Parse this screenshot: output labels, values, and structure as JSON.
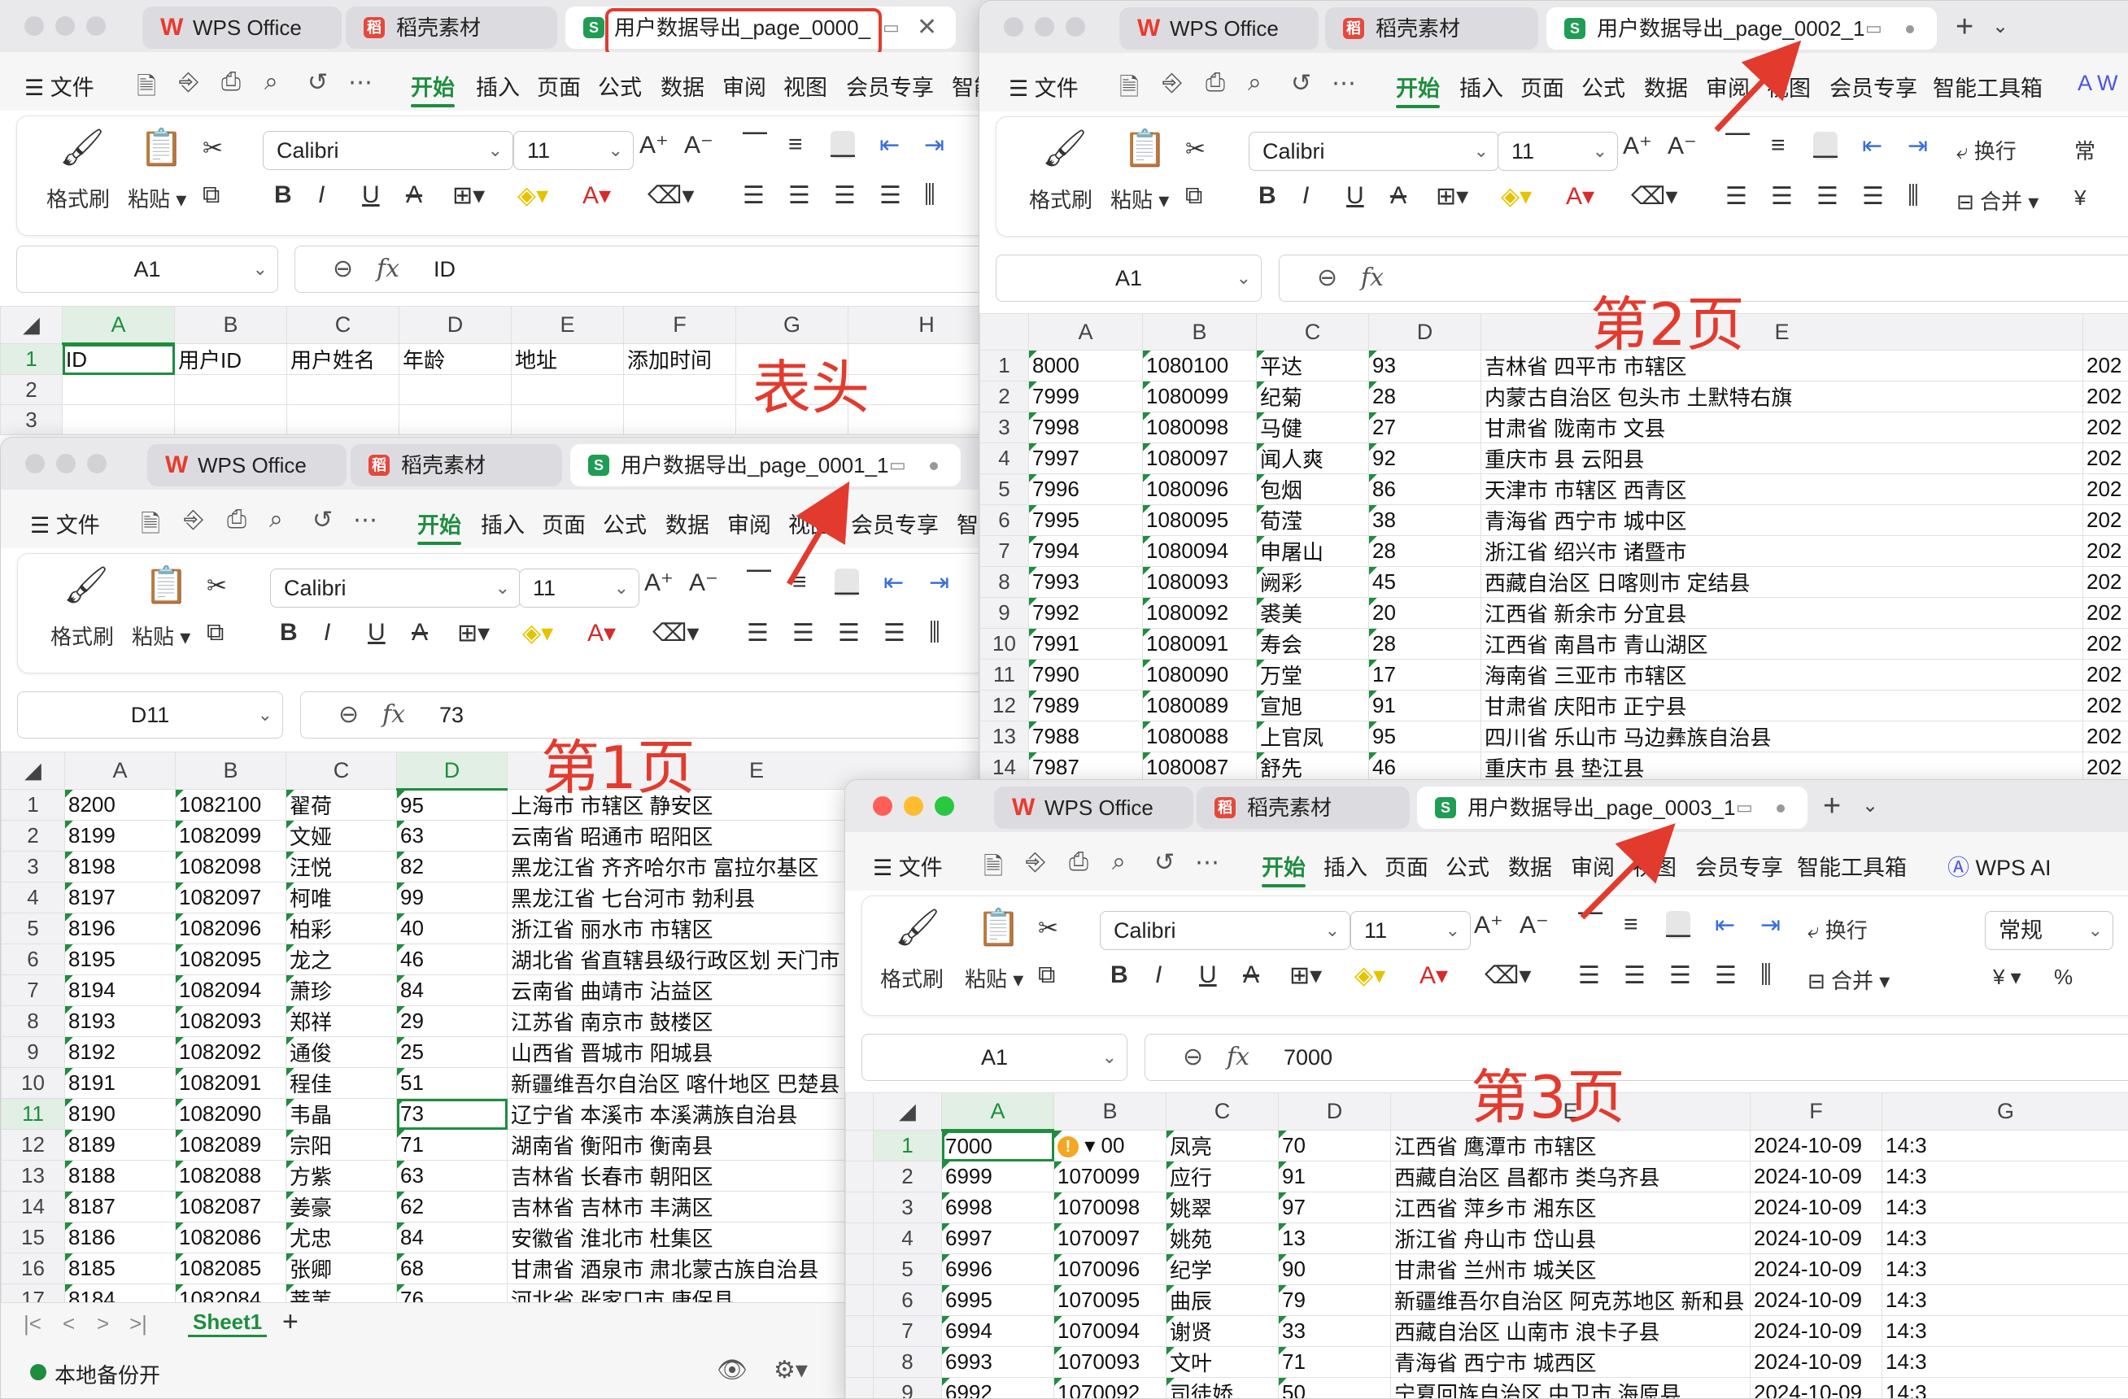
{
  "app": {
    "wps_tab": "WPS Office",
    "daoke_tab": "稻壳素材",
    "sheet_icon": "S",
    "wps_icon": "W",
    "daoke_icon": "稻"
  },
  "windows": [
    {
      "file_tab": "用户数据导出_page_0000_",
      "cell_ref": "A1",
      "formula_value": "ID"
    },
    {
      "file_tab": "用户数据导出_page_0001_1",
      "cell_ref": "D11",
      "formula_value": "73"
    },
    {
      "file_tab": "用户数据导出_page_0002_1",
      "cell_ref": "A1",
      "formula_value": ""
    },
    {
      "file_tab": "用户数据导出_page_0003_1",
      "cell_ref": "A1",
      "formula_value": "7000"
    }
  ],
  "menu": {
    "file": "文件",
    "items": [
      "开始",
      "插入",
      "页面",
      "公式",
      "数据",
      "审阅",
      "视图",
      "会员专享",
      "智能工具箱",
      "智能"
    ],
    "wps_ai": "WPS AI"
  },
  "ribbon": {
    "format_painter": "格式刷",
    "paste": "粘贴",
    "font_name": "Calibri",
    "font_size": "11",
    "wrap": "换行",
    "merge": "合并",
    "number_format": "常规",
    "number_format_short": "常"
  },
  "fx_label": "fx",
  "sheet0": {
    "columns": [
      "A",
      "B",
      "C",
      "D",
      "E",
      "F",
      "G",
      "H"
    ],
    "rows": [
      [
        "1",
        "ID",
        "用户ID",
        "用户姓名",
        "年龄",
        "地址",
        "添加时间",
        "",
        ""
      ],
      [
        "2",
        "",
        "",
        "",
        "",
        "",
        "",
        "",
        ""
      ],
      [
        "3",
        "",
        "",
        "",
        "",
        "",
        "",
        "",
        ""
      ]
    ]
  },
  "sheet1": {
    "columns": [
      "A",
      "B",
      "C",
      "D",
      "E"
    ],
    "rows": [
      [
        "1",
        "8200",
        "1082100",
        "翟荷",
        "95",
        "上海市 市辖区 静安区"
      ],
      [
        "2",
        "8199",
        "1082099",
        "文娅",
        "63",
        "云南省 昭通市 昭阳区"
      ],
      [
        "3",
        "8198",
        "1082098",
        "汪悦",
        "82",
        "黑龙江省 齐齐哈尔市 富拉尔基区"
      ],
      [
        "4",
        "8197",
        "1082097",
        "柯唯",
        "99",
        "黑龙江省 七台河市 勃利县"
      ],
      [
        "5",
        "8196",
        "1082096",
        "柏彩",
        "40",
        "浙江省 丽水市 市辖区"
      ],
      [
        "6",
        "8195",
        "1082095",
        "龙之",
        "46",
        "湖北省 省直辖县级行政区划 天门市"
      ],
      [
        "7",
        "8194",
        "1082094",
        "萧珍",
        "84",
        "云南省 曲靖市 沾益区"
      ],
      [
        "8",
        "8193",
        "1082093",
        "郑祥",
        "29",
        "江苏省 南京市 鼓楼区"
      ],
      [
        "9",
        "8192",
        "1082092",
        "通俊",
        "25",
        "山西省 晋城市 阳城县"
      ],
      [
        "10",
        "8191",
        "1082091",
        "程佳",
        "51",
        "新疆维吾尔自治区 喀什地区 巴楚县"
      ],
      [
        "11",
        "8190",
        "1082090",
        "韦晶",
        "73",
        "辽宁省 本溪市 本溪满族自治县"
      ],
      [
        "12",
        "8189",
        "1082089",
        "宗阳",
        "71",
        "湖南省 衡阳市 衡南县"
      ],
      [
        "13",
        "8188",
        "1082088",
        "方紫",
        "63",
        "吉林省 长春市 朝阳区"
      ],
      [
        "14",
        "8187",
        "1082087",
        "姜豪",
        "62",
        "吉林省 吉林市 丰满区"
      ],
      [
        "15",
        "8186",
        "1082086",
        "尤忠",
        "84",
        "安徽省 淮北市 杜集区"
      ],
      [
        "16",
        "8185",
        "1082085",
        "张卿",
        "68",
        "甘肃省 酒泉市 肃北蒙古族自治县"
      ],
      [
        "17",
        "8184",
        "1082084",
        "莘苇",
        "76",
        "河北省 张家口市 康保县"
      ]
    ],
    "sheet_tab": "Sheet1",
    "status": "本地备份开"
  },
  "sheet2": {
    "columns": [
      "A",
      "B",
      "C",
      "D",
      "E"
    ],
    "rows": [
      [
        "1",
        "8000",
        "1080100",
        "平达",
        "93",
        "吉林省 四平市 市辖区",
        "202"
      ],
      [
        "2",
        "7999",
        "1080099",
        "纪菊",
        "28",
        "内蒙古自治区 包头市 土默特右旗",
        "202"
      ],
      [
        "3",
        "7998",
        "1080098",
        "马健",
        "27",
        "甘肃省 陇南市 文县",
        "202"
      ],
      [
        "4",
        "7997",
        "1080097",
        "闻人爽",
        "92",
        "重庆市 县 云阳县",
        "202"
      ],
      [
        "5",
        "7996",
        "1080096",
        "包烟",
        "86",
        "天津市 市辖区 西青区",
        "202"
      ],
      [
        "6",
        "7995",
        "1080095",
        "荀滢",
        "38",
        "青海省 西宁市 城中区",
        "202"
      ],
      [
        "7",
        "7994",
        "1080094",
        "申屠山",
        "28",
        "浙江省 绍兴市 诸暨市",
        "202"
      ],
      [
        "8",
        "7993",
        "1080093",
        "阙彩",
        "45",
        "西藏自治区 日喀则市 定结县",
        "202"
      ],
      [
        "9",
        "7992",
        "1080092",
        "裘美",
        "20",
        "江西省 新余市 分宜县",
        "202"
      ],
      [
        "10",
        "7991",
        "1080091",
        "寿会",
        "28",
        "江西省 南昌市 青山湖区",
        "202"
      ],
      [
        "11",
        "7990",
        "1080090",
        "万堂",
        "17",
        "海南省 三亚市 市辖区",
        "202"
      ],
      [
        "12",
        "7989",
        "1080089",
        "宣旭",
        "91",
        "甘肃省 庆阳市 正宁县",
        "202"
      ],
      [
        "13",
        "7988",
        "1080088",
        "上官凤",
        "95",
        "四川省 乐山市 马边彝族自治县",
        "202"
      ],
      [
        "14",
        "7987",
        "1080087",
        "舒先",
        "46",
        "重庆市 县 垫江县",
        "202"
      ]
    ]
  },
  "sheet3": {
    "columns": [
      "A",
      "B",
      "C",
      "D",
      "E",
      "F",
      "G"
    ],
    "rows": [
      [
        "1",
        "7000",
        "00",
        "凤亮",
        "70",
        "江西省 鹰潭市 市辖区",
        "2024-10-09",
        "14:3"
      ],
      [
        "2",
        "6999",
        "1070099",
        "应行",
        "91",
        "西藏自治区 昌都市 类乌齐县",
        "2024-10-09",
        "14:3"
      ],
      [
        "3",
        "6998",
        "1070098",
        "姚翠",
        "97",
        "江西省 萍乡市 湘东区",
        "2024-10-09",
        "14:3"
      ],
      [
        "4",
        "6997",
        "1070097",
        "姚苑",
        "13",
        "浙江省 舟山市 岱山县",
        "2024-10-09",
        "14:3"
      ],
      [
        "5",
        "6996",
        "1070096",
        "纪学",
        "90",
        "甘肃省 兰州市 城关区",
        "2024-10-09",
        "14:3"
      ],
      [
        "6",
        "6995",
        "1070095",
        "曲辰",
        "79",
        "新疆维吾尔自治区 阿克苏地区 新和县",
        "2024-10-09",
        "14:3"
      ],
      [
        "7",
        "6994",
        "1070094",
        "谢贤",
        "33",
        "西藏自治区 山南市 浪卡子县",
        "2024-10-09",
        "14:3"
      ],
      [
        "8",
        "6993",
        "1070093",
        "文叶",
        "71",
        "青海省 西宁市 城西区",
        "2024-10-09",
        "14:3"
      ],
      [
        "9",
        "6992",
        "1070092",
        "司徒娇",
        "50",
        "宁夏回族自治区 中卫市 海原县",
        "2024-10-09",
        "14:3"
      ]
    ]
  },
  "annotations": {
    "header": "表头",
    "page1": "第1页",
    "page2": "第2页",
    "page3": "第3页"
  }
}
